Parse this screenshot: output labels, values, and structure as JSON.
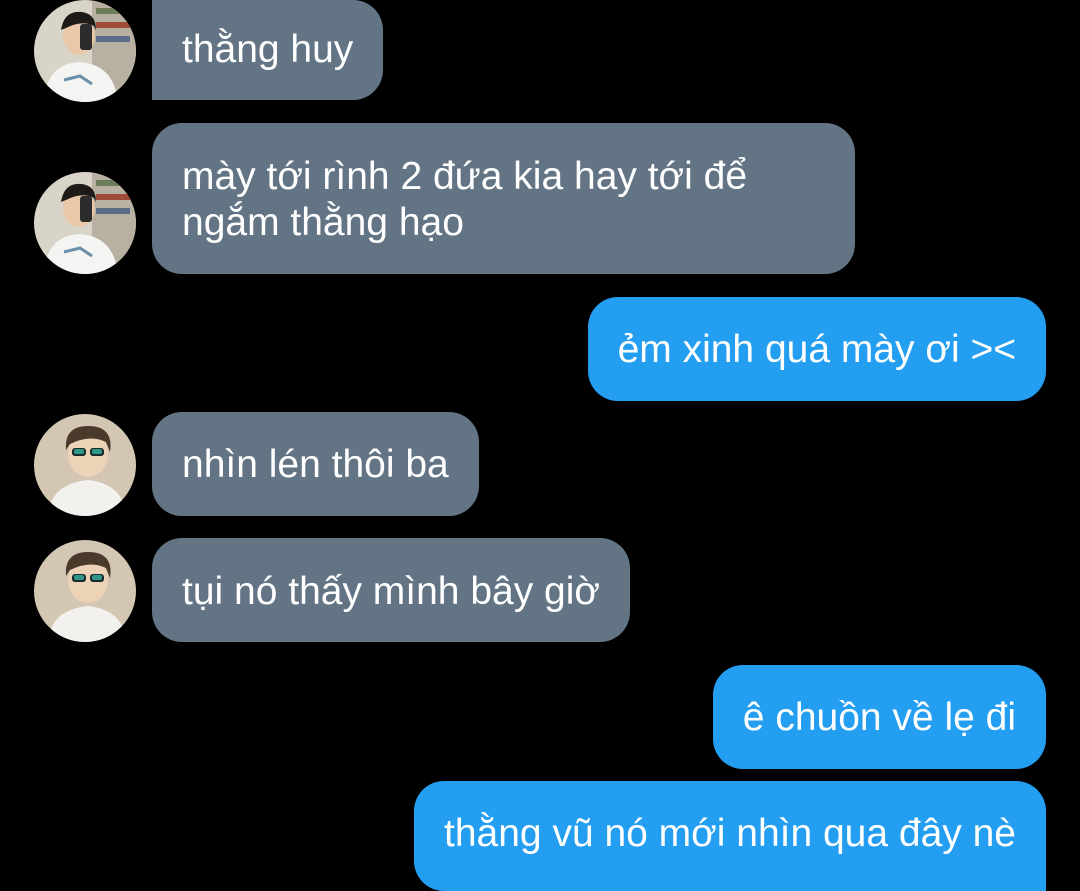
{
  "conversation": {
    "messages": [
      {
        "sender": "other-a",
        "direction": "incoming",
        "text": "thằng huy"
      },
      {
        "sender": "other-a",
        "direction": "incoming",
        "text": "mày tới rình 2 đứa kia hay tới để ngắm thằng hạo"
      },
      {
        "sender": "self",
        "direction": "outgoing",
        "text": "ẻm xinh quá mày ơi ><"
      },
      {
        "sender": "other-b",
        "direction": "incoming",
        "text": "nhìn lén thôi ba"
      },
      {
        "sender": "other-b",
        "direction": "incoming",
        "text": "tụi nó thấy mình bây giờ"
      },
      {
        "sender": "self",
        "direction": "outgoing",
        "text": "ê chuồn về lẹ đi"
      },
      {
        "sender": "self",
        "direction": "outgoing",
        "text": "thằng vũ nó mới nhìn qua đây nè"
      }
    ]
  },
  "colors": {
    "background": "#000000",
    "incoming_bubble": "#637485",
    "outgoing_bubble": "#239ef0",
    "text": "#ffffff"
  },
  "icons": {
    "avatar_a": "person-selfie-avatar-icon",
    "avatar_b": "person-sunglasses-avatar-icon"
  }
}
